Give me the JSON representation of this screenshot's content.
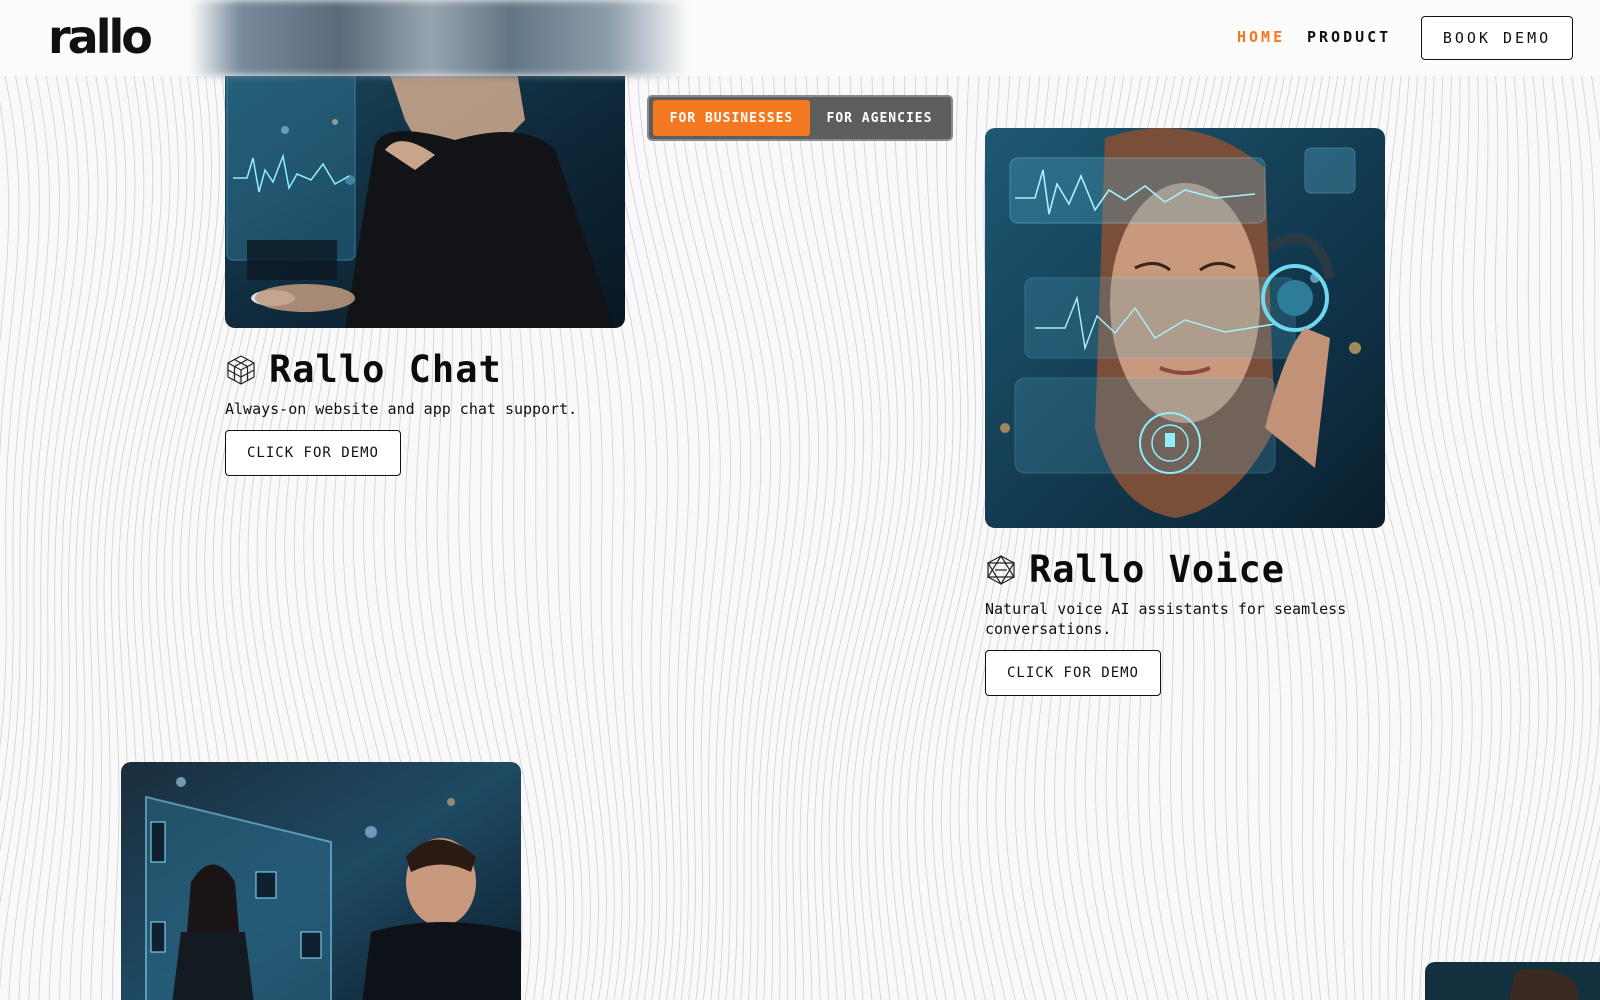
{
  "header": {
    "logo": "rallo",
    "nav": {
      "home": "HOME",
      "product": "PRODUCT"
    },
    "book_demo": "BOOK DEMO"
  },
  "toggle": {
    "businesses": "FOR BUSINESSES",
    "agencies": "FOR AGENCIES",
    "active": "businesses"
  },
  "products": {
    "chat": {
      "name": "Rallo Chat",
      "description": "Always-on website and app chat support.",
      "cta": "CLICK FOR DEMO",
      "icon": "cube-icon"
    },
    "voice": {
      "name": "Rallo Voice",
      "description": "Natural voice AI assistants for seamless conversations.",
      "cta": "CLICK FOR DEMO",
      "icon": "polyhedron-icon"
    }
  },
  "colors": {
    "accent": "#f4781f",
    "text": "#0b0b0b",
    "background": "#f9f9f9",
    "toggle_bg": "#5d5d5d"
  }
}
